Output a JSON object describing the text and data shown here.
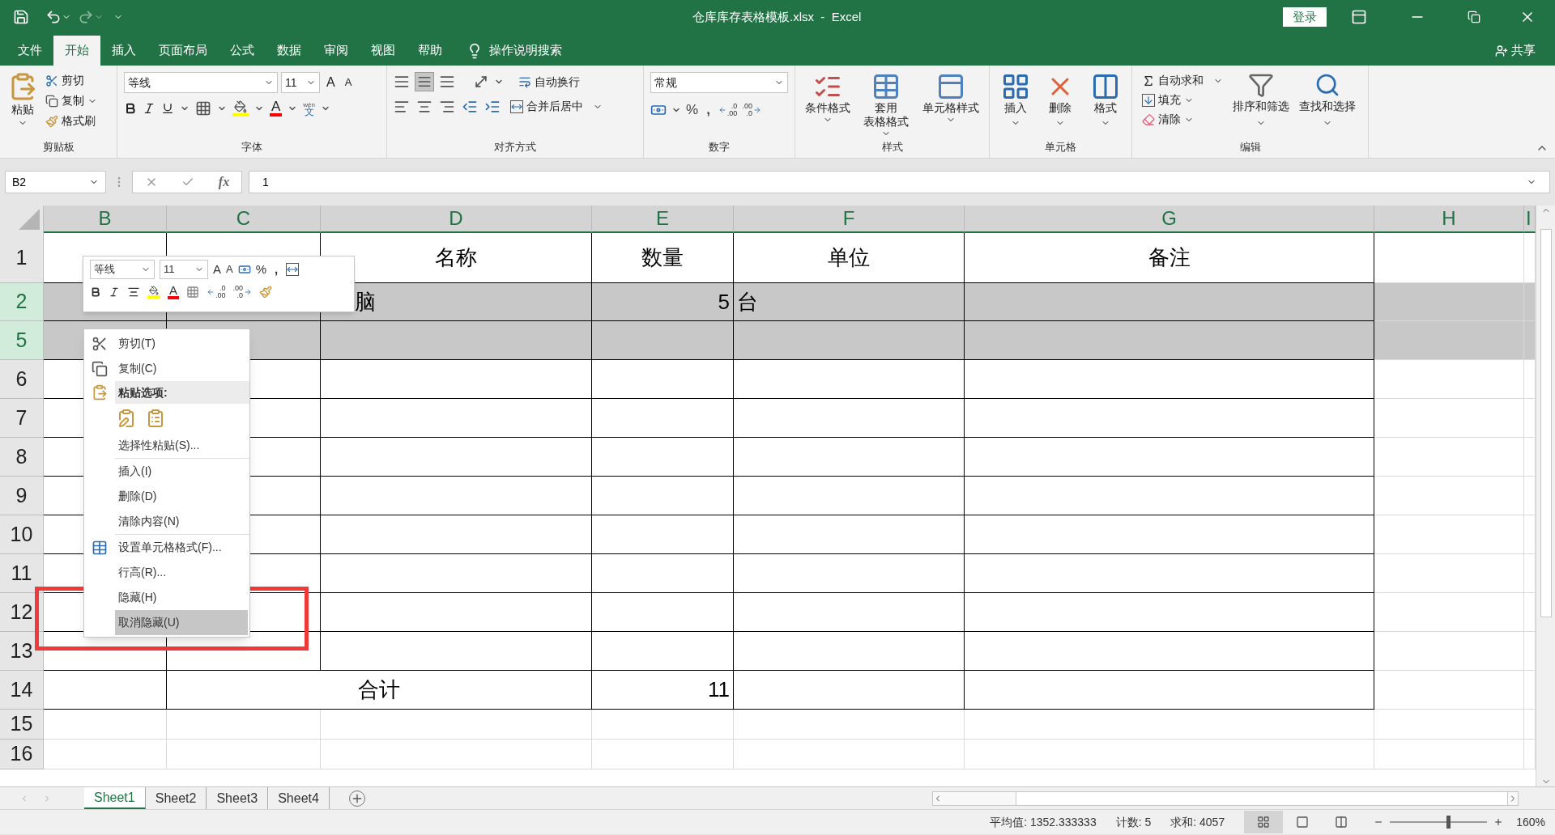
{
  "window": {
    "title": "仓库库存表格模板.xlsx  -  Excel",
    "sign_in": "登录"
  },
  "menu_tabs": [
    {
      "label": "文件",
      "selected": false
    },
    {
      "label": "开始",
      "selected": true
    },
    {
      "label": "插入",
      "selected": false
    },
    {
      "label": "页面布局",
      "selected": false
    },
    {
      "label": "公式",
      "selected": false
    },
    {
      "label": "数据",
      "selected": false
    },
    {
      "label": "审阅",
      "selected": false
    },
    {
      "label": "视图",
      "selected": false
    },
    {
      "label": "帮助",
      "selected": false
    }
  ],
  "tell_me": "操作说明搜索",
  "share": "共享",
  "ribbon": {
    "clipboard": {
      "label": "剪贴板",
      "paste": "粘贴",
      "cut": "剪切",
      "copy": "复制",
      "format_painter": "格式刷"
    },
    "font": {
      "label": "字体",
      "font_name": "等线",
      "font_size": "11",
      "grow_font": "A",
      "shrink_font": "A",
      "font_color": "A",
      "phonetic_top": "wén",
      "phonetic_bottom": "文"
    },
    "alignment": {
      "label": "对齐方式",
      "wrap": "自动换行",
      "merge": "合并后居中"
    },
    "number": {
      "label": "数字",
      "format": "常规",
      "percent": "%",
      "comma": ",",
      "decimals": [
        {
          "top": ".0",
          "bottom": ".00"
        },
        {
          "top": ".00",
          "bottom": ".0"
        }
      ]
    },
    "styles": {
      "label": "样式",
      "buttons": [
        {
          "lines": [
            "条件格式"
          ],
          "kind": "conditional"
        },
        {
          "lines": [
            "套用",
            "表格格式"
          ],
          "kind": "table"
        },
        {
          "lines": [
            "单元格样式"
          ],
          "kind": "cell"
        }
      ]
    },
    "cells": {
      "label": "单元格",
      "buttons": [
        {
          "label": "插入",
          "kind": "insert"
        },
        {
          "label": "删除",
          "kind": "delete"
        },
        {
          "label": "格式",
          "kind": "format"
        }
      ]
    },
    "editing": {
      "label": "编辑",
      "autosum": "自动求和",
      "fill": "填充",
      "clear": "清除",
      "sort": "排序和筛选",
      "find": "查找和选择"
    }
  },
  "formula_bar": {
    "name_box": "B2",
    "fx": "fx",
    "formula": "1"
  },
  "sheet": {
    "columns": [
      "B",
      "C",
      "D",
      "E",
      "F",
      "G",
      "H",
      "I"
    ],
    "rows": [
      {
        "header": "1",
        "kind": "header",
        "selected": false,
        "d": "名称",
        "e": "数量",
        "f": "单位",
        "g": "备注"
      },
      {
        "header": "2",
        "kind": "body",
        "selected": true,
        "d": "脑",
        "e": "5",
        "f": "台"
      },
      {
        "header": "5",
        "kind": "body",
        "selected": true
      },
      {
        "header": "6",
        "kind": "body",
        "selected": false
      },
      {
        "header": "7",
        "kind": "body",
        "selected": false
      },
      {
        "header": "8",
        "kind": "body",
        "selected": false
      },
      {
        "header": "9",
        "kind": "body",
        "selected": false
      },
      {
        "header": "10",
        "kind": "body",
        "selected": false
      },
      {
        "header": "11",
        "kind": "body",
        "selected": false
      },
      {
        "header": "12",
        "kind": "body",
        "selected": false
      },
      {
        "header": "13",
        "kind": "body",
        "selected": false
      },
      {
        "header": "14",
        "kind": "total",
        "selected": false,
        "cd": "合计",
        "e": "11"
      },
      {
        "header": "15",
        "kind": "extra",
        "selected": false
      },
      {
        "header": "16",
        "kind": "extra",
        "selected": false
      }
    ]
  },
  "mini_toolbar": {
    "font_name": "等线",
    "font_size": "11",
    "grow_font": "A",
    "shrink_font": "A",
    "percent": "%",
    "comma": ",",
    "font_color": "A",
    "decimals": [
      {
        "top": ".0",
        "bottom": ".00"
      },
      {
        "top": ".00",
        "bottom": ".0"
      }
    ]
  },
  "context_menu": {
    "groups": [
      [
        {
          "kind": "cut",
          "label": "剪切(T)",
          "highlighted": false
        },
        {
          "kind": "copy",
          "label": "复制(C)",
          "highlighted": false
        },
        {
          "kind": "paste_header",
          "label": "粘贴选项:",
          "highlighted": false
        },
        {
          "kind": "paste_icons",
          "highlighted": false
        },
        {
          "kind": "plain",
          "label": "选择性粘贴(S)...",
          "highlighted": false
        }
      ],
      [
        {
          "kind": "plain",
          "label": "插入(I)",
          "highlighted": false
        },
        {
          "kind": "plain",
          "label": "删除(D)",
          "highlighted": false
        },
        {
          "kind": "plain",
          "label": "清除内容(N)",
          "highlighted": false
        }
      ],
      [
        {
          "kind": "format",
          "label": "设置单元格格式(F)...",
          "highlighted": false
        },
        {
          "kind": "plain",
          "label": "行高(R)...",
          "highlighted": false
        },
        {
          "kind": "plain",
          "label": "隐藏(H)",
          "highlighted": false
        },
        {
          "kind": "plain",
          "label": "取消隐藏(U)",
          "highlighted": true
        }
      ]
    ]
  },
  "sheet_tabs": [
    {
      "label": "Sheet1",
      "selected": true
    },
    {
      "label": "Sheet2",
      "selected": false
    },
    {
      "label": "Sheet3",
      "selected": false
    },
    {
      "label": "Sheet4",
      "selected": false
    }
  ],
  "status_bar": {
    "average": "平均值: 1352.333333",
    "count": "计数: 5",
    "sum": "求和: 4057",
    "views": [
      {
        "kind": "normal",
        "selected": true
      },
      {
        "kind": "page_layout",
        "selected": false
      },
      {
        "kind": "page_break",
        "selected": false
      }
    ],
    "zoom_slider": {
      "level": 0.58
    },
    "zoom": "160%"
  }
}
